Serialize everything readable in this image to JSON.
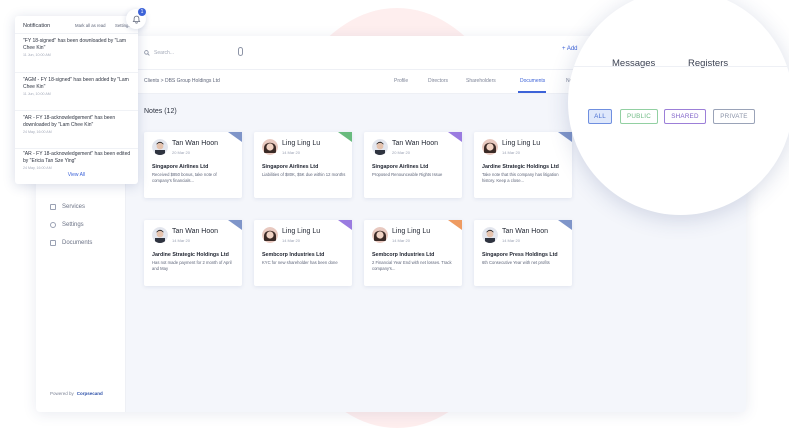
{
  "sidebar": {
    "items": [
      {
        "label": "Services",
        "icon": "services-icon"
      },
      {
        "label": "Settings",
        "icon": "gear-icon"
      },
      {
        "label": "Documents",
        "icon": "document-icon"
      }
    ],
    "powered_by": "Powered by",
    "brand": "Corpsecand"
  },
  "topbar": {
    "search_placeholder": "Search...",
    "add_label": "+ Add"
  },
  "breadcrumb": "Clients > DBS Group Holdings Ltd",
  "tabs": [
    {
      "label": "Profile",
      "active": false
    },
    {
      "label": "Directors",
      "active": false
    },
    {
      "label": "Shareholders",
      "active": false
    },
    {
      "label": "Documents",
      "active": true
    },
    {
      "label": "Note",
      "active": false
    }
  ],
  "notes_title": "Notes (12)",
  "notes": [
    {
      "name": "Tan Wan Hoon",
      "date": "20 Mar 20",
      "company": "Singapore Airlines Ltd",
      "desc": "Received $850 bonus, take note of company's financials...",
      "tag_color": "#7f95c9",
      "avatar": "male"
    },
    {
      "name": "Ling Ling Lu",
      "date": "14 Mar 20",
      "company": "Singapore Airlines Ltd",
      "desc": "Liabilities of $80K, $5K due within 12 months",
      "tag_color": "#69bb7e",
      "avatar": "female"
    },
    {
      "name": "Tan Wan Hoon",
      "date": "20 Mar 20",
      "company": "Singapore Airlines Ltd",
      "desc": "Proposed Renounceable Rights Issue",
      "tag_color": "#9a7be0",
      "avatar": "male"
    },
    {
      "name": "Ling Ling Lu",
      "date": "14 Mar 20",
      "company": "Jardine Strategic Holdings Ltd",
      "desc": "Take note that this company has litigation history. Keep a close...",
      "tag_color": "#7f95c9",
      "avatar": "female"
    },
    {
      "name": "Tan Wan Hoon",
      "date": "14 Mar 20",
      "company": "Jardine Strategic Holdings Ltd",
      "desc": "Has not made payment for 2 month of April and May",
      "tag_color": "#7f95c9",
      "avatar": "male"
    },
    {
      "name": "Ling Ling Lu",
      "date": "14 Mar 20",
      "company": "Sembcorp Industries Ltd",
      "desc": "KYC for new shareholder has been done",
      "tag_color": "#9a7be0",
      "avatar": "female"
    },
    {
      "name": "Ling Ling Lu",
      "date": "14 Mar 20",
      "company": "Sembcorp Industries Ltd",
      "desc": "2 Financial Year End with net losses. Track company's...",
      "tag_color": "#ee9b62",
      "avatar": "female"
    },
    {
      "name": "Tan Wan Hoon",
      "date": "14 Mar 20",
      "company": "Singapore Press Holdings Ltd",
      "desc": "6th Consecutive Year with net profits",
      "tag_color": "#7f95c9",
      "avatar": "male"
    }
  ],
  "notification": {
    "title": "Notification",
    "mark_all": "Mark all as read",
    "settings": "Settings",
    "items": [
      {
        "text": "\"FY 18-signed\" has been downloaded by \"Lam Chee Kin\"",
        "time": "11 Jun, 10:00 AM"
      },
      {
        "text": "\"AGM - FY 18-signed\" has been added by \"Lam Chee Kin\"",
        "time": "11 Jun, 10:00 AM"
      },
      {
        "text": "\"AR - FY 18-acknowledgement\" has been downloaded by \"Lam Chee Kin\"",
        "time": "24 May, 16:00 AM"
      },
      {
        "text": "\"AR - FY 18-acknowledgement\" has been edited by \"Ericia Tan Sze Ying\"",
        "time": "24 May, 16:00 AM"
      }
    ],
    "view_all": "View All",
    "badge": "1"
  },
  "magnifier": {
    "tabs": [
      "Messages",
      "Registers"
    ],
    "filters": [
      {
        "label": "ALL",
        "color": "#6f8fe0",
        "bg": "#dfe8fb",
        "text": "#4a6fd0"
      },
      {
        "label": "PUBLIC",
        "color": "#92d0a2",
        "bg": "#ffffff",
        "text": "#6fbb84"
      },
      {
        "label": "SHARED",
        "color": "#9c7fd8",
        "bg": "#ffffff",
        "text": "#7f61c8"
      },
      {
        "label": "PRIVATE",
        "color": "#9aa3b8",
        "bg": "#ffffff",
        "text": "#8891a6"
      }
    ]
  },
  "colors": {
    "accent": "#3d63d8"
  }
}
